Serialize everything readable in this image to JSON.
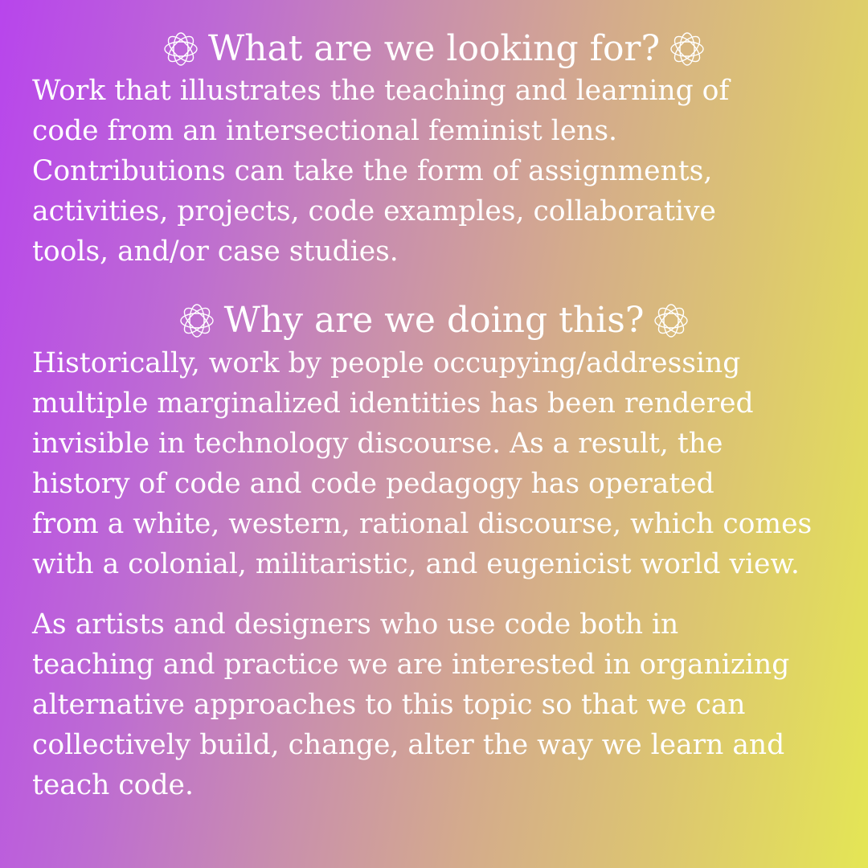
{
  "colors": {
    "gradient_start": "#b845ec",
    "gradient_end": "#e4e655",
    "text": "#ffffff"
  },
  "icon": "flower-outline-icon",
  "section1": {
    "heading": "What are we looking for?",
    "lines": [
      "Work that illustrates the teaching and learning of",
      "code from an intersectional feminist lens.",
      "Contributions can take the form of assignments,",
      "activities, projects, code examples, collaborative",
      "tools, and/or case studies."
    ]
  },
  "section2": {
    "heading": "Why are we doing this?",
    "paragraph1": [
      "Historically, work by people occupying/addressing",
      "multiple marginalized identities has been rendered",
      "invisible in technology discourse. As a result, the",
      "history of code and code pedagogy has operated",
      "from a white, western, rational discourse, which comes",
      "with a colonial, militaristic, and eugenicist world view."
    ],
    "paragraph2": [
      "As artists and designers who use code both in",
      "teaching and practice we are interested in organizing",
      "alternative approaches to this topic so that we can",
      "collectively build, change, alter the way we learn and",
      "teach code."
    ]
  }
}
